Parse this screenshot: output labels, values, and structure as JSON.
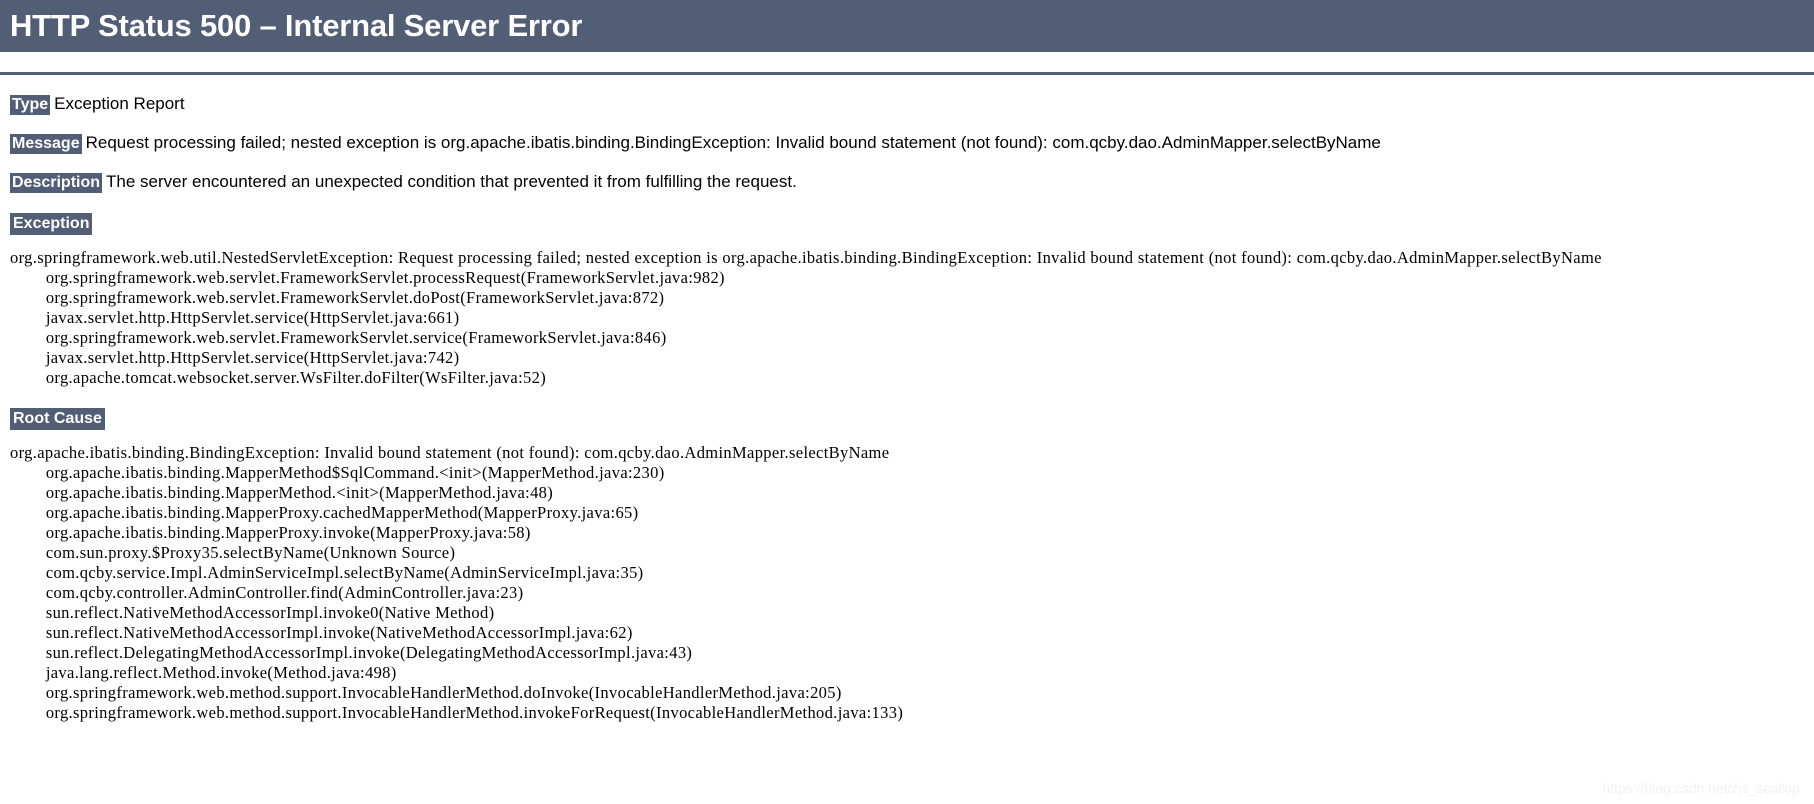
{
  "page": {
    "title": "HTTP Status 500 – Internal Server Error",
    "colors": {
      "header_background": "#525D76",
      "header_text": "#ffffff",
      "body_background": "#ffffff",
      "body_text": "#000000",
      "watermark_text": "#f2f2f2"
    }
  },
  "fields": [
    {
      "label": "Type",
      "value": "Exception Report"
    },
    {
      "label": "Message",
      "value": "Request processing failed; nested exception is org.apache.ibatis.binding.BindingException: Invalid bound statement (not found): com.qcby.dao.AdminMapper.selectByName"
    },
    {
      "label": "Description",
      "value": "The server encountered an unexpected condition that prevented it from fulfilling the request."
    }
  ],
  "sections": [
    {
      "heading": "Exception",
      "lines": [
        "org.springframework.web.util.NestedServletException: Request processing failed; nested exception is org.apache.ibatis.binding.BindingException: Invalid bound statement (not found): com.qcby.dao.AdminMapper.selectByName",
        "\torg.springframework.web.servlet.FrameworkServlet.processRequest(FrameworkServlet.java:982)",
        "\torg.springframework.web.servlet.FrameworkServlet.doPost(FrameworkServlet.java:872)",
        "\tjavax.servlet.http.HttpServlet.service(HttpServlet.java:661)",
        "\torg.springframework.web.servlet.FrameworkServlet.service(FrameworkServlet.java:846)",
        "\tjavax.servlet.http.HttpServlet.service(HttpServlet.java:742)",
        "\torg.apache.tomcat.websocket.server.WsFilter.doFilter(WsFilter.java:52)"
      ]
    },
    {
      "heading": "Root Cause",
      "lines": [
        "org.apache.ibatis.binding.BindingException: Invalid bound statement (not found): com.qcby.dao.AdminMapper.selectByName",
        "\torg.apache.ibatis.binding.MapperMethod$SqlCommand.<init>(MapperMethod.java:230)",
        "\torg.apache.ibatis.binding.MapperMethod.<init>(MapperMethod.java:48)",
        "\torg.apache.ibatis.binding.MapperProxy.cachedMapperMethod(MapperProxy.java:65)",
        "\torg.apache.ibatis.binding.MapperProxy.invoke(MapperProxy.java:58)",
        "\tcom.sun.proxy.$Proxy35.selectByName(Unknown Source)",
        "\tcom.qcby.service.Impl.AdminServiceImpl.selectByName(AdminServiceImpl.java:35)",
        "\tcom.qcby.controller.AdminController.find(AdminController.java:23)",
        "\tsun.reflect.NativeMethodAccessorImpl.invoke0(Native Method)",
        "\tsun.reflect.NativeMethodAccessorImpl.invoke(NativeMethodAccessorImpl.java:62)",
        "\tsun.reflect.DelegatingMethodAccessorImpl.invoke(DelegatingMethodAccessorImpl.java:43)",
        "\tjava.lang.reflect.Method.invoke(Method.java:498)",
        "\torg.springframework.web.method.support.InvocableHandlerMethod.doInvoke(InvocableHandlerMethod.java:205)",
        "\torg.springframework.web.method.support.InvocableHandlerMethod.invokeForRequest(InvocableHandlerMethod.java:133)"
      ]
    }
  ],
  "watermark": {
    "text": "https://blog.csdn.net/zjs_scallop"
  }
}
